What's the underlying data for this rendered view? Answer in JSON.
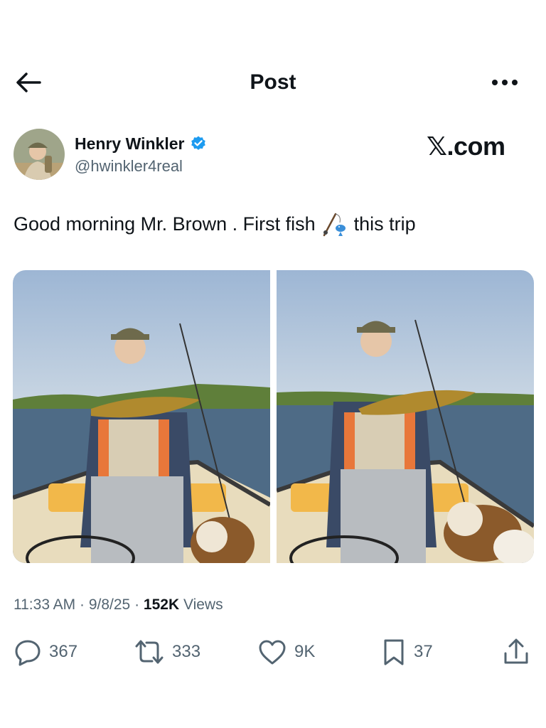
{
  "header": {
    "title": "Post",
    "back_icon": "arrow-left-icon",
    "more_icon": "more-horizontal-icon"
  },
  "author": {
    "name": "Henry Winkler",
    "handle": "@hwinkler4real",
    "verified_icon": "verified-badge-icon",
    "verified_color": "#1d9bf0"
  },
  "watermark": "𝕏.com",
  "post": {
    "text_before": "Good morning Mr. Brown . First fish",
    "emoji_icon": "fishing-pole-and-fish-icon",
    "text_after": "this trip"
  },
  "images": [
    {
      "description_icon": "photo-icon"
    },
    {
      "description_icon": "photo-icon"
    }
  ],
  "meta": {
    "time": "11:33 AM",
    "date": "9/8/25",
    "views_count": "152K",
    "views_label": "Views"
  },
  "actions": {
    "replies": "367",
    "reposts": "333",
    "likes": "9K",
    "bookmarks": "37"
  },
  "colors": {
    "text_primary": "#0f1419",
    "text_secondary": "#536471",
    "accent": "#1d9bf0"
  }
}
